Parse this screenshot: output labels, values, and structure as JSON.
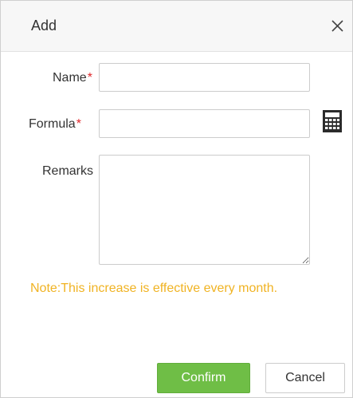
{
  "dialog": {
    "title": "Add",
    "close_icon": "close-icon"
  },
  "form": {
    "name": {
      "label": "Name",
      "required_mark": "*",
      "value": ""
    },
    "formula": {
      "label": "Formula",
      "required_mark": "*",
      "value": "",
      "icon": "calculator-icon"
    },
    "remarks": {
      "label": "Remarks",
      "value": ""
    }
  },
  "note": "Note:This increase is effective every month.",
  "buttons": {
    "confirm": "Confirm",
    "cancel": "Cancel"
  },
  "colors": {
    "confirm_bg": "#6fbe46",
    "note_text": "#f0b323",
    "required_mark": "#e0272b"
  }
}
